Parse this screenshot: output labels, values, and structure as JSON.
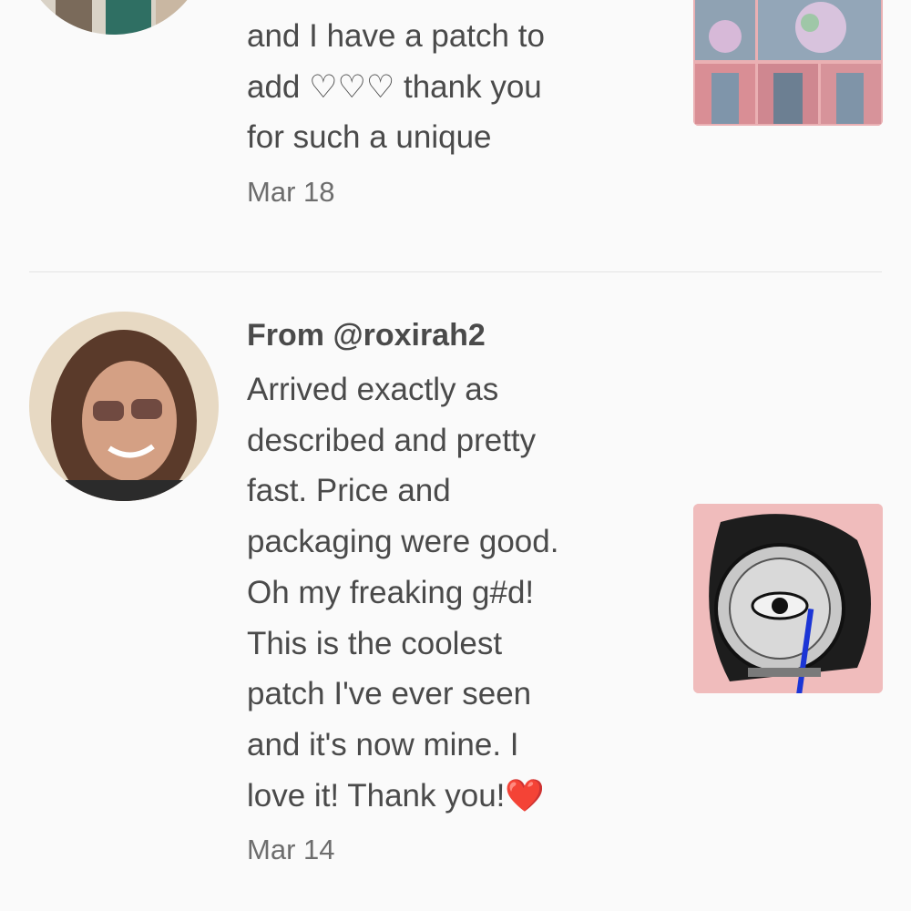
{
  "reviews": [
    {
      "author": "",
      "body_lines": [
        "and I have a patch to",
        "add ♡♡♡ thank you",
        "for such a unique"
      ],
      "date": "Mar 18",
      "avatar_icon": "user-avatar-photo",
      "thumbnail_icon": "denim-jacket-collage-photo"
    },
    {
      "author": "From @roxirah2",
      "body_lines": [
        "Arrived exactly as",
        "described and pretty",
        "fast. Price and",
        "packaging were good.",
        "Oh my freaking g#d!",
        "This is the coolest",
        "patch I've ever seen",
        "and it's now mine. I",
        "love it! Thank you!"
      ],
      "heart_emoji": "❤️",
      "date": "Mar 14",
      "avatar_icon": "user-avatar-photo",
      "thumbnail_icon": "eye-patch-photo"
    }
  ],
  "colors": {
    "background": "#fafafa",
    "text": "#4a4a4a",
    "date": "#6d6d6d",
    "divider": "#e4e4e4"
  }
}
